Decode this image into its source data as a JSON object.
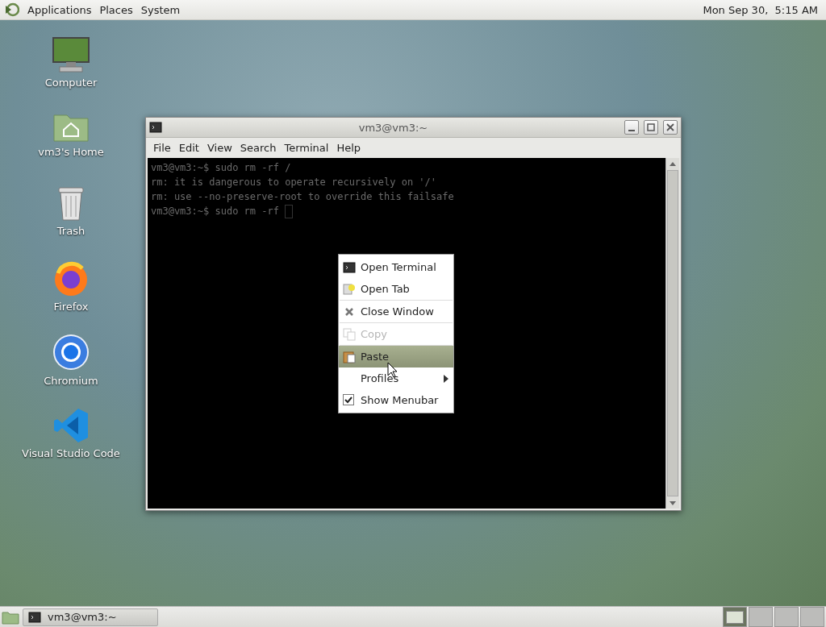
{
  "top_panel": {
    "menus": [
      "Applications",
      "Places",
      "System"
    ],
    "clock": "Mon Sep 30,  5:15 AM"
  },
  "desktop_icons": [
    {
      "label": "Computer"
    },
    {
      "label": "vm3's Home"
    },
    {
      "label": "Trash"
    },
    {
      "label": "Firefox"
    },
    {
      "label": "Chromium"
    },
    {
      "label": "Visual Studio Code"
    }
  ],
  "window": {
    "title": "vm3@vm3:~",
    "menus": [
      "File",
      "Edit",
      "View",
      "Search",
      "Terminal",
      "Help"
    ],
    "terminal_lines": [
      "vm3@vm3:~$ sudo rm -rf /",
      "rm: it is dangerous to operate recursively on '/'",
      "rm: use --no-preserve-root to override this failsafe",
      "vm3@vm3:~$ sudo rm -rf "
    ]
  },
  "context_menu": {
    "items": [
      {
        "kind": "action",
        "label": "Open Terminal",
        "disabled": false,
        "selected": false
      },
      {
        "kind": "action",
        "label": "Open Tab",
        "disabled": false,
        "selected": false
      },
      {
        "kind": "separator"
      },
      {
        "kind": "action",
        "label": "Close Window",
        "disabled": false,
        "selected": false
      },
      {
        "kind": "separator"
      },
      {
        "kind": "action",
        "label": "Copy",
        "disabled": true,
        "selected": false
      },
      {
        "kind": "separator"
      },
      {
        "kind": "action",
        "label": "Paste",
        "disabled": false,
        "selected": true
      },
      {
        "kind": "submenu",
        "label": "Profiles",
        "disabled": false,
        "selected": false
      },
      {
        "kind": "check",
        "label": "Show Menubar",
        "disabled": false,
        "selected": false,
        "checked": true
      }
    ]
  },
  "taskbar": {
    "windows": [
      {
        "label": "vm3@vm3:~"
      }
    ],
    "workspaces": [
      {
        "selected": true
      },
      {
        "selected": false
      },
      {
        "selected": false
      },
      {
        "selected": false
      }
    ]
  }
}
